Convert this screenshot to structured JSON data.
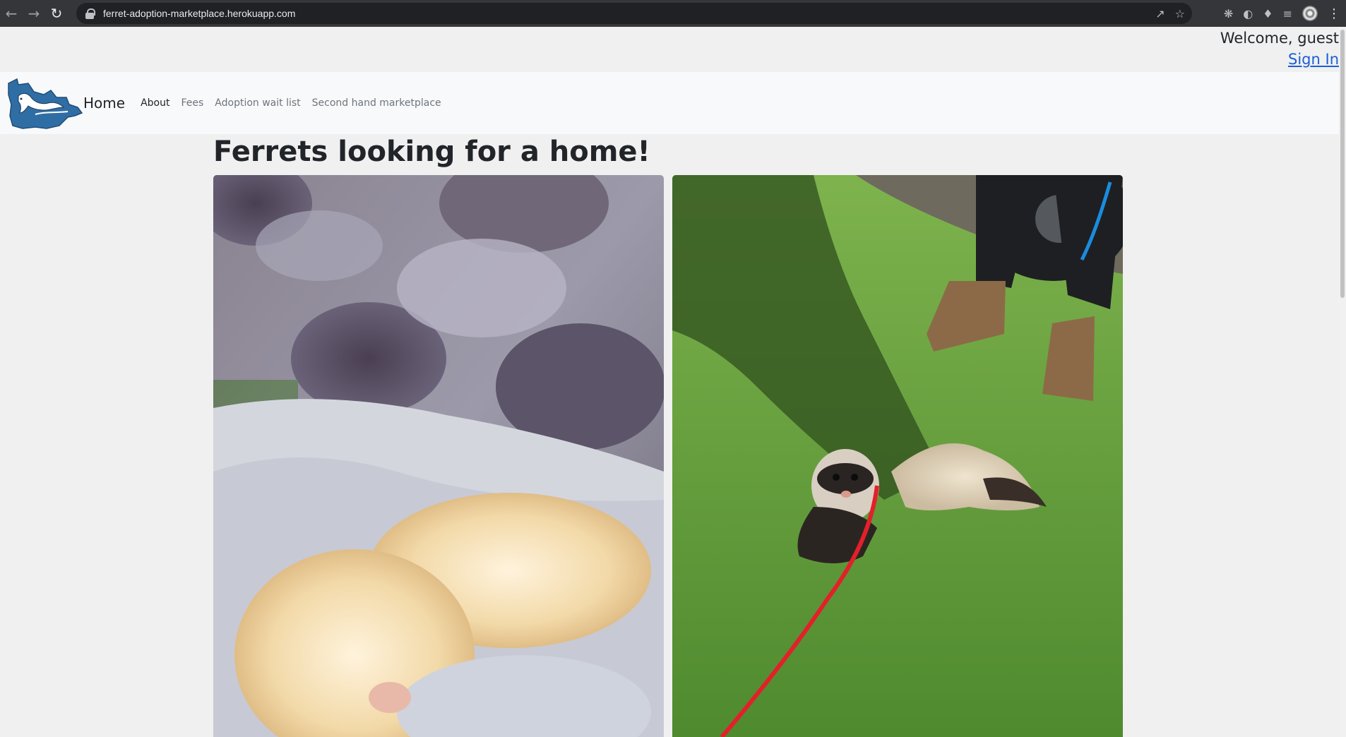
{
  "browser": {
    "url": "ferret-adoption-marketplace.herokuapp.com",
    "icons": [
      "back-icon",
      "forward-icon",
      "reload-icon",
      "lock-icon",
      "share-icon",
      "star-icon",
      "extension-icon",
      "puzzle-icon",
      "reading-list-icon",
      "profile-avatar",
      "menu-icon"
    ]
  },
  "header": {
    "welcome": "Welcome, guest",
    "sign_in": "Sign In"
  },
  "navbar": {
    "brand": "Home",
    "links": [
      {
        "label": "About",
        "active": true
      },
      {
        "label": "Fees",
        "active": false
      },
      {
        "label": "Adoption wait list",
        "active": false
      },
      {
        "label": "Second hand marketplace",
        "active": false
      }
    ]
  },
  "main": {
    "title": "Ferrets looking for a home!"
  },
  "colors": {
    "link": "#1a5fd6",
    "navbar_bg": "#f8f9fa",
    "page_bg": "#f0f0f0"
  }
}
